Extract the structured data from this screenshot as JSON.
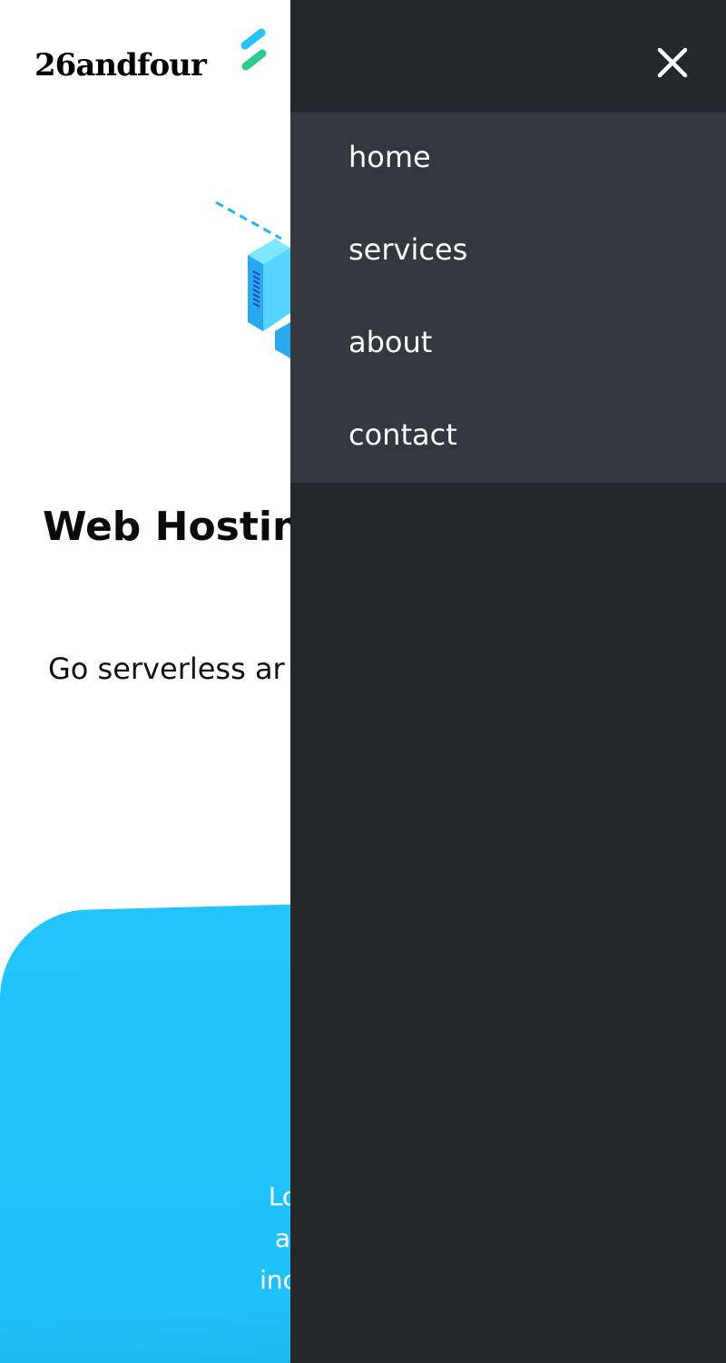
{
  "brand": {
    "logo_text": "26andfour"
  },
  "hero": {
    "title": "Web Hostin",
    "subtitle": "Go serverless ar"
  },
  "card": {
    "lines": [
      "Lorem ipsum d",
      "adipiscing elit",
      "incididunt ut lab"
    ]
  },
  "nav": {
    "items": [
      {
        "label": "home"
      },
      {
        "label": "services"
      },
      {
        "label": "about"
      },
      {
        "label": "contact"
      }
    ]
  },
  "icons": {
    "menu": "hamburger-icon",
    "close": "close-icon",
    "hero": "server-illustration"
  },
  "colors": {
    "drawer_bg": "#24282b",
    "nav_bg": "#33383c",
    "accent_blue": "#22c4fb",
    "accent_green": "#2ecc8a"
  }
}
